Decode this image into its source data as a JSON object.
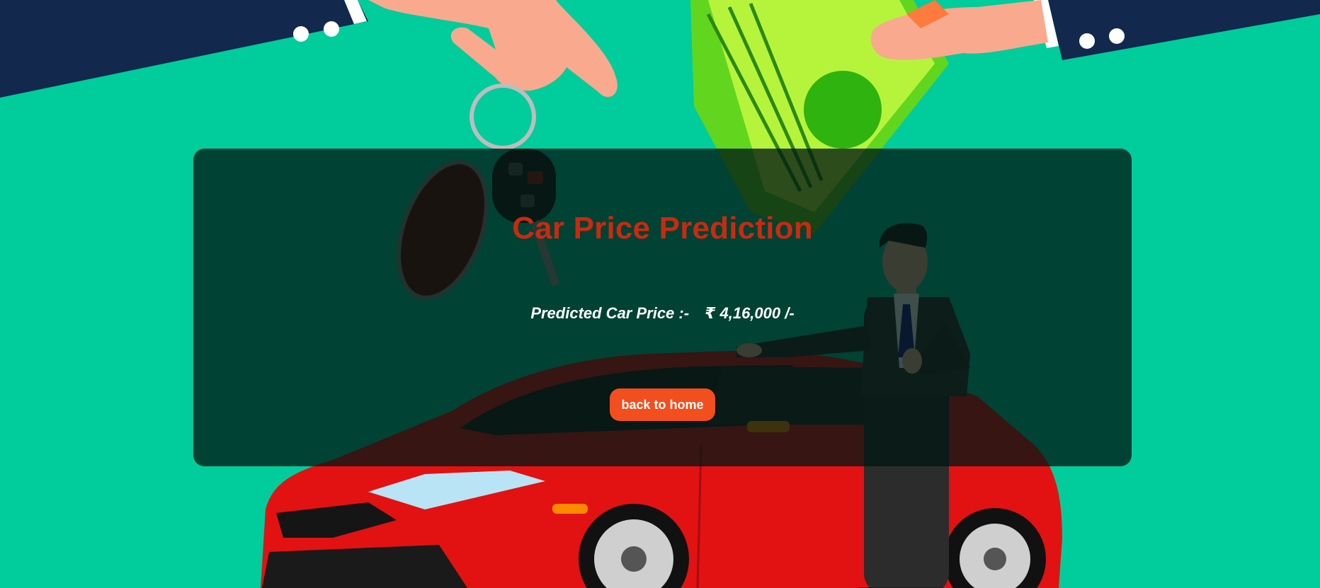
{
  "page": {
    "title": "Car Price Prediction",
    "background_color": "#00cc9c",
    "accent_color": "#c82a10"
  },
  "result": {
    "label": "Predicted Car Price :-",
    "value": "₹ 4,16,000 /-"
  },
  "actions": {
    "back_label": "back to home",
    "button_color": "#f24e1e"
  },
  "illustration": {
    "icons": [
      "hand-with-car-key-icon",
      "hand-with-money-icon",
      "red-car-icon",
      "salesman-icon"
    ]
  }
}
